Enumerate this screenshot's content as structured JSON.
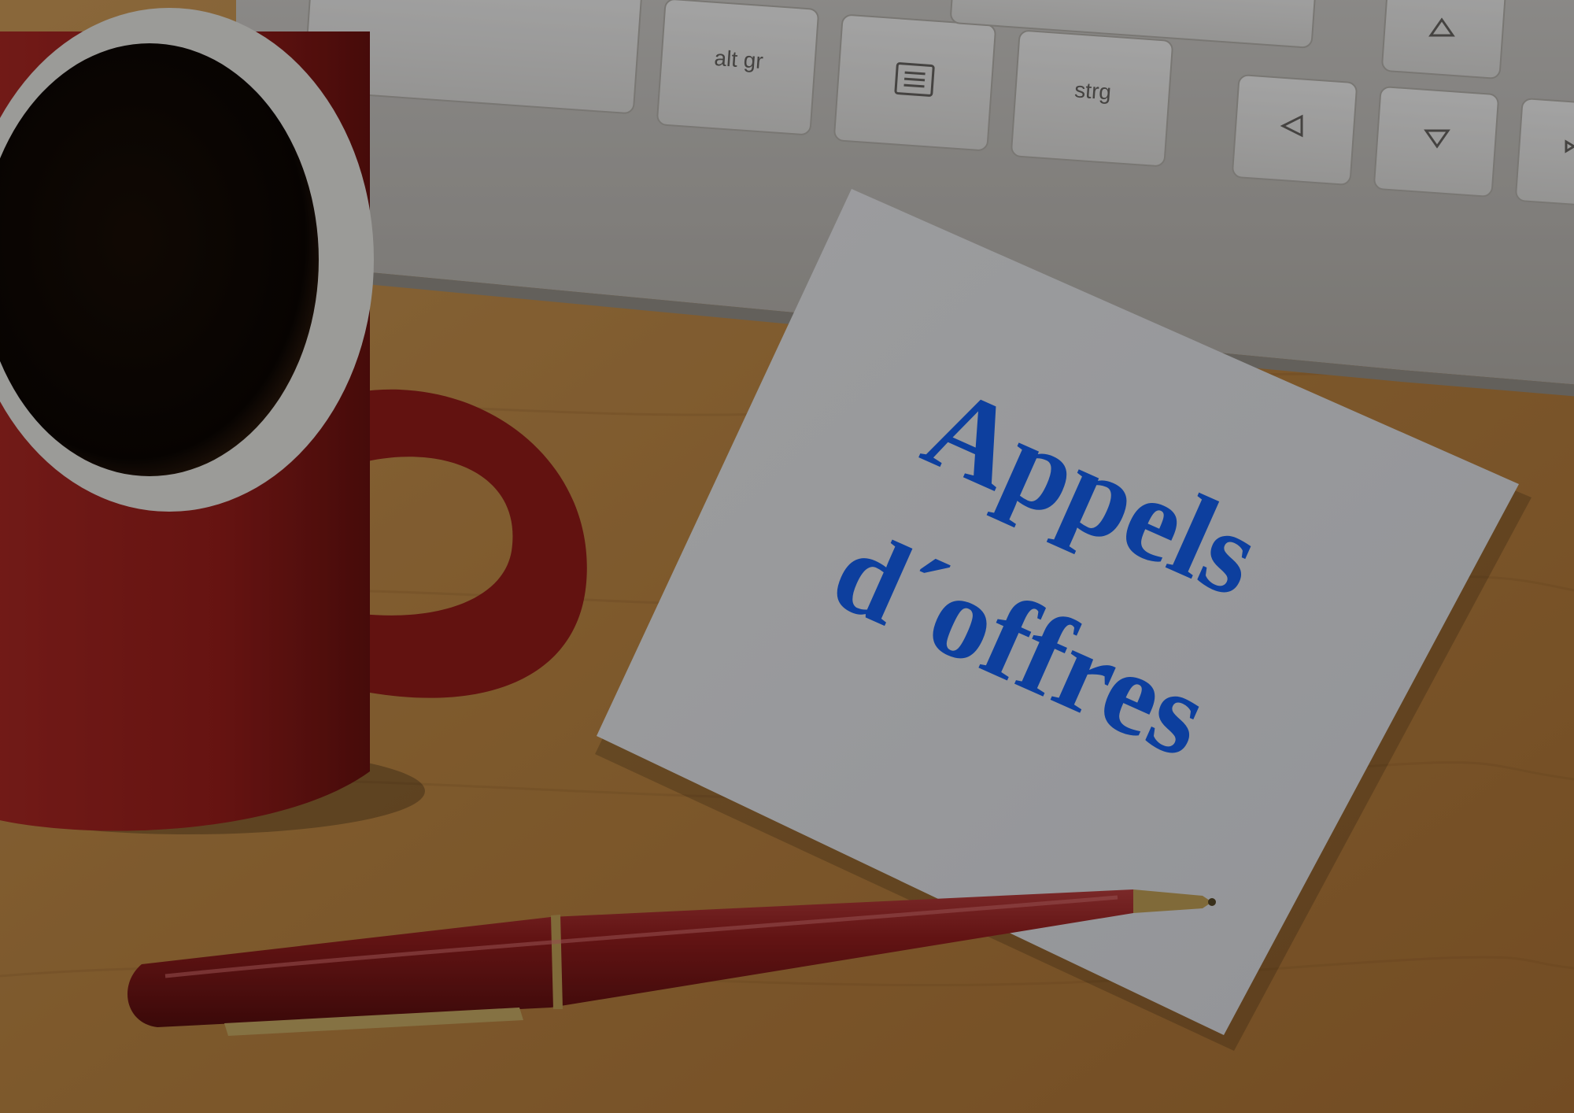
{
  "note": {
    "line1": "Appels",
    "line2": "d´offres"
  },
  "keyboard": {
    "key_altgr": "alt gr",
    "key_strg": "strg"
  },
  "colors": {
    "desk": "#c08a45",
    "mug": "#a5221f",
    "pen": "#8e1c1c",
    "ink": "#0d3f9e",
    "paper": "#eef0f4",
    "keyboard": "#c9c6c2"
  },
  "icons": {
    "menu_key": "menu-key-icon",
    "arrow_up": "arrow-up-icon",
    "arrow_left": "arrow-left-icon",
    "arrow_down": "arrow-down-icon",
    "arrow_right": "arrow-right-icon"
  }
}
